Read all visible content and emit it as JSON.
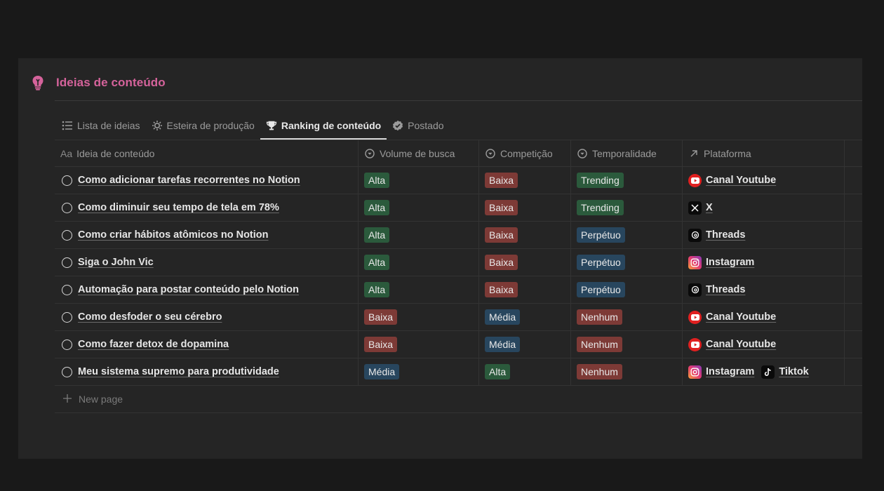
{
  "database": {
    "title": "Ideias de conteúdo",
    "icon": "lightbulb-icon"
  },
  "tabs": [
    {
      "label": "Lista de ideias",
      "icon": "list-icon",
      "active": false
    },
    {
      "label": "Esteira de produção",
      "icon": "gear-icon",
      "active": false
    },
    {
      "label": "Ranking de conteúdo",
      "icon": "trophy-icon",
      "active": true
    },
    {
      "label": "Postado",
      "icon": "verified-badge-icon",
      "active": false
    }
  ],
  "columns": {
    "name": {
      "prefix": "Aa",
      "label": "Ideia de conteúdo"
    },
    "volume": {
      "label": "Volume de busca",
      "icon": "select-icon"
    },
    "competicao": {
      "label": "Competição",
      "icon": "select-icon"
    },
    "temporalidade": {
      "label": "Temporalidade",
      "icon": "select-icon"
    },
    "plataforma": {
      "label": "Plataforma",
      "icon": "relation-arrow-icon"
    }
  },
  "rows": [
    {
      "name": "Como adicionar tarefas recorrentes no Notion",
      "volume": "Alta",
      "competicao": "Baixa",
      "temporalidade": "Trending",
      "plataformas": [
        "Canal Youtube"
      ]
    },
    {
      "name": "Como diminuir seu tempo de tela em 78%",
      "volume": "Alta",
      "competicao": "Baixa",
      "temporalidade": "Trending",
      "plataformas": [
        "X"
      ]
    },
    {
      "name": "Como criar hábitos atômicos no Notion",
      "volume": "Alta",
      "competicao": "Baixa",
      "temporalidade": "Perpétuo",
      "plataformas": [
        "Threads"
      ]
    },
    {
      "name": "Siga o John Vic",
      "volume": "Alta",
      "competicao": "Baixa",
      "temporalidade": "Perpétuo",
      "plataformas": [
        "Instagram"
      ]
    },
    {
      "name": "Automação para postar conteúdo pelo Notion",
      "volume": "Alta",
      "competicao": "Baixa",
      "temporalidade": "Perpétuo",
      "plataformas": [
        "Threads"
      ]
    },
    {
      "name": "Como desfoder o seu cérebro",
      "volume": "Baixa",
      "competicao": "Média",
      "temporalidade": "Nenhum",
      "plataformas": [
        "Canal Youtube"
      ]
    },
    {
      "name": "Como fazer detox de dopamina",
      "volume": "Baixa",
      "competicao": "Média",
      "temporalidade": "Nenhum",
      "plataformas": [
        "Canal Youtube"
      ]
    },
    {
      "name": "Meu sistema supremo para produtividade",
      "volume": "Média",
      "competicao": "Alta",
      "temporalidade": "Nenhum",
      "plataformas": [
        "Instagram",
        "Tiktok"
      ]
    }
  ],
  "new_page": {
    "label": "New page",
    "icon": "plus-icon"
  },
  "colors": {
    "title_pink": "#d5639b",
    "tag_green": "#2b5a3c",
    "tag_red": "#7d3a36",
    "tag_blue": "#28465e"
  }
}
